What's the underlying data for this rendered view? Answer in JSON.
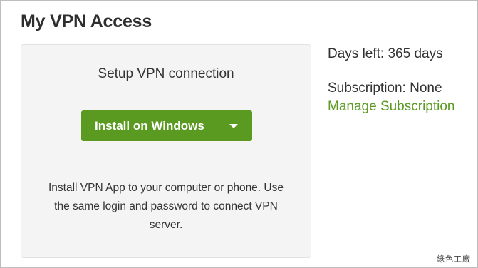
{
  "page": {
    "title": "My VPN Access"
  },
  "setup": {
    "heading": "Setup VPN connection",
    "install_button_label": "Install on Windows",
    "description": "Install VPN App to your computer or phone. Use the same login and password to connect VPN server."
  },
  "account": {
    "days_left": "Days left: 365 days",
    "subscription": "Subscription: None",
    "manage_link": "Manage Subscription"
  },
  "watermark": {
    "text": "綠色工廠"
  },
  "colors": {
    "accent_green": "#5a9a21",
    "panel_bg": "#f4f4f4"
  },
  "icons": {
    "dropdown": "chevron-down-icon"
  }
}
